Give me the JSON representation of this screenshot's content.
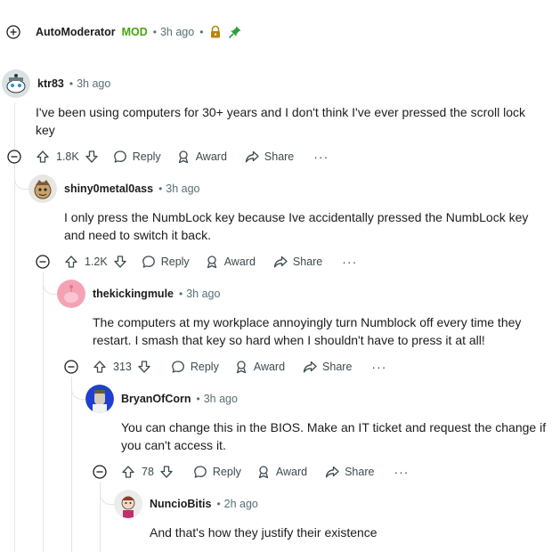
{
  "top_comment": {
    "username": "AutoModerator",
    "mod_badge": "MOD",
    "time": "3h ago",
    "icons": [
      "expand-icon",
      "lock-icon",
      "pin-icon"
    ]
  },
  "comments": [
    {
      "username": "ktr83",
      "time": "3h ago",
      "body": "I've been using computers for 30+ years and I don't think I've ever pressed the scroll lock key",
      "votes": "1.8K",
      "reply": "Reply",
      "award": "Award",
      "share": "Share",
      "more": "···"
    },
    {
      "username": "shiny0metal0ass",
      "time": "3h ago",
      "body": "I only press the NumbLock key because Ive accidentally pressed the NumbLock key and need to switch it back.",
      "votes": "1.2K",
      "reply": "Reply",
      "award": "Award",
      "share": "Share",
      "more": "···"
    },
    {
      "username": "thekickingmule",
      "time": "3h ago",
      "body": "The computers at my workplace annoyingly turn Numblock off every time they restart. I smash that key so hard when I shouldn't have to press it at all!",
      "votes": "313",
      "reply": "Reply",
      "award": "Award",
      "share": "Share",
      "more": "···"
    },
    {
      "username": "BryanOfCorn",
      "time": "3h ago",
      "body": "You can change this in the BIOS. Make an IT ticket and request the change if you can't access it.",
      "votes": "78",
      "reply": "Reply",
      "award": "Award",
      "share": "Share",
      "more": "···"
    },
    {
      "username": "NuncioBitis",
      "time": "2h ago",
      "body": "And that's how they justify their existence"
    }
  ],
  "colors": {
    "mod_green": "#46a508",
    "meta_gray": "#576f76",
    "thread_line": "#e3e5e7",
    "lock_gold": "#b8860b",
    "pin_green": "#2e9e3e"
  }
}
